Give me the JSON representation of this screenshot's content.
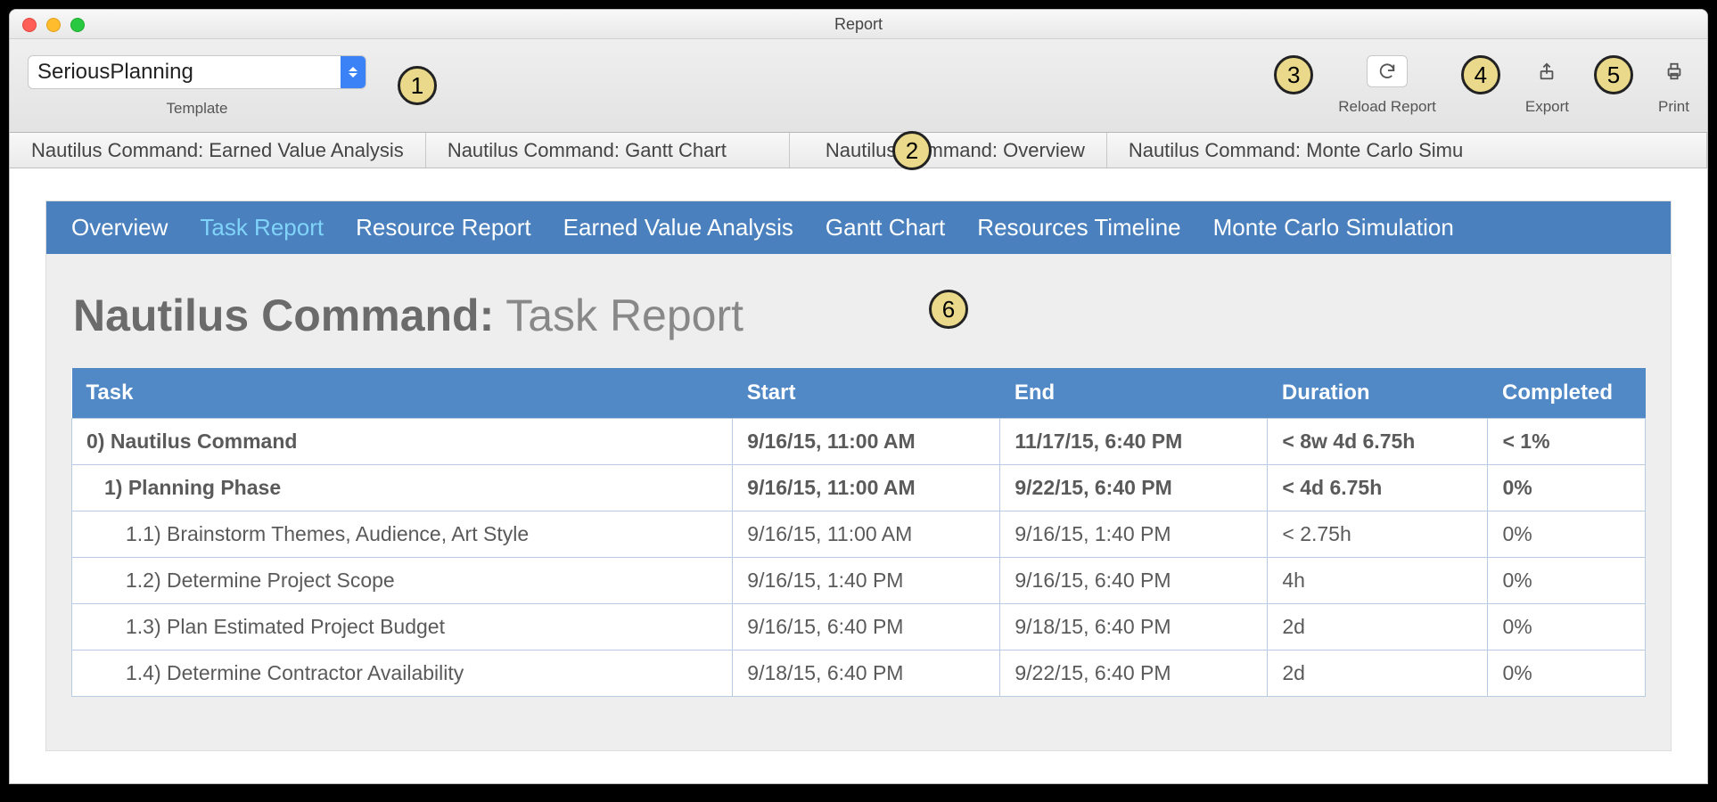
{
  "window": {
    "title": "Report"
  },
  "toolbar": {
    "template_value": "SeriousPlanning",
    "template_label": "Template",
    "reload_label": "Reload Report",
    "export_label": "Export",
    "print_label": "Print"
  },
  "callouts": [
    "1",
    "2",
    "3",
    "4",
    "5",
    "6"
  ],
  "doc_tabs": [
    "Nautilus Command: Earned Value Analysis",
    "Nautilus Command: Gantt Chart",
    "Nautilus Command: Overview",
    "Nautilus Command: Monte Carlo Simu"
  ],
  "report_nav": {
    "items": [
      "Overview",
      "Task Report",
      "Resource Report",
      "Earned Value Analysis",
      "Gantt Chart",
      "Resources Timeline",
      "Monte Carlo Simulation"
    ],
    "active_index": 1
  },
  "report": {
    "title_bold": "Nautilus Command:",
    "title_rest": " Task Report"
  },
  "table": {
    "headers": [
      "Task",
      "Start",
      "End",
      "Duration",
      "Completed"
    ],
    "rows": [
      {
        "bold": true,
        "indent": 0,
        "cells": [
          "0) Nautilus Command",
          "9/16/15, 11:00 AM",
          "11/17/15, 6:40 PM",
          "< 8w 4d 6.75h",
          "< 1%"
        ]
      },
      {
        "bold": true,
        "indent": 1,
        "cells": [
          "1) Planning Phase",
          "9/16/15, 11:00 AM",
          "9/22/15, 6:40 PM",
          "< 4d 6.75h",
          "0%"
        ]
      },
      {
        "bold": false,
        "indent": 2,
        "cells": [
          "1.1) Brainstorm Themes, Audience, Art Style",
          "9/16/15, 11:00 AM",
          "9/16/15, 1:40 PM",
          "< 2.75h",
          "0%"
        ]
      },
      {
        "bold": false,
        "indent": 2,
        "cells": [
          "1.2) Determine Project Scope",
          "9/16/15, 1:40 PM",
          "9/16/15, 6:40 PM",
          "4h",
          "0%"
        ]
      },
      {
        "bold": false,
        "indent": 2,
        "cells": [
          "1.3) Plan Estimated Project Budget",
          "9/16/15, 6:40 PM",
          "9/18/15, 6:40 PM",
          "2d",
          "0%"
        ]
      },
      {
        "bold": false,
        "indent": 2,
        "cells": [
          "1.4) Determine Contractor Availability",
          "9/18/15, 6:40 PM",
          "9/22/15, 6:40 PM",
          "2d",
          "0%"
        ]
      }
    ]
  }
}
